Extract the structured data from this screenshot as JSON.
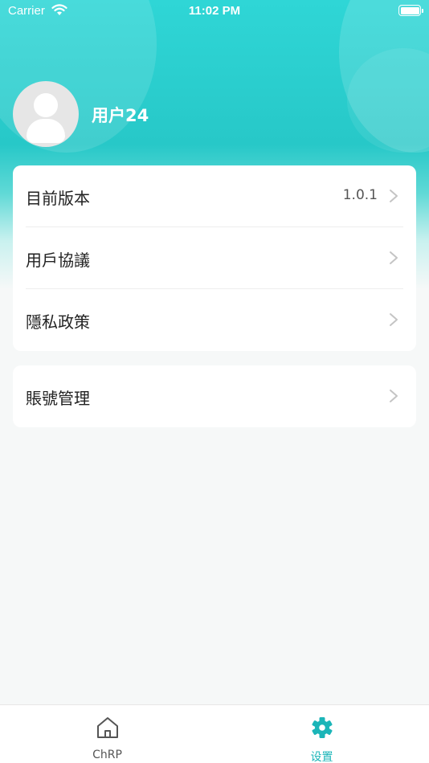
{
  "status_bar": {
    "carrier": "Carrier",
    "time": "11:02 PM"
  },
  "profile": {
    "username": "用户24"
  },
  "menu_group_1": [
    {
      "label": "目前版本",
      "value": "1.0.1"
    },
    {
      "label": "用戶協議",
      "value": ""
    },
    {
      "label": "隱私政策",
      "value": ""
    }
  ],
  "menu_group_2": [
    {
      "label": "賬號管理",
      "value": ""
    }
  ],
  "tabbar": {
    "tabs": [
      {
        "label": "ChRP",
        "icon": "home-icon",
        "active": false
      },
      {
        "label": "设置",
        "icon": "gear-icon",
        "active": true
      }
    ]
  },
  "colors": {
    "accent": "#1bb5b8",
    "header": "#2fd6d6",
    "background": "#f6f8f8"
  }
}
